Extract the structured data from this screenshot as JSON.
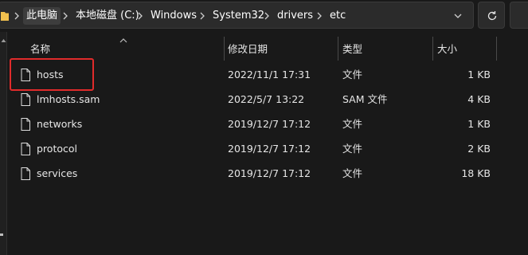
{
  "address_bar": {
    "breadcrumbs": [
      "此电脑",
      "本地磁盘 (C:)",
      "Windows",
      "System32",
      "drivers",
      "etc"
    ],
    "chevron_icon": "chevron-right-icon",
    "folder_icon": "folder-icon",
    "refresh_icon": "refresh-icon"
  },
  "columns": {
    "name": "名称",
    "modified": "修改日期",
    "type": "类型",
    "size": "大小"
  },
  "files": [
    {
      "name": "hosts",
      "modified": "2022/11/1 17:31",
      "type": "文件",
      "size": "1 KB",
      "selected_highlight": true
    },
    {
      "name": "lmhosts.sam",
      "modified": "2022/5/7 13:22",
      "type": "SAM 文件",
      "size": "4 KB"
    },
    {
      "name": "networks",
      "modified": "2019/12/7 17:12",
      "type": "文件",
      "size": "1 KB"
    },
    {
      "name": "protocol",
      "modified": "2019/12/7 17:12",
      "type": "文件",
      "size": "2 KB"
    },
    {
      "name": "services",
      "modified": "2019/12/7 17:12",
      "type": "文件",
      "size": "18 KB"
    }
  ],
  "colors": {
    "background": "#191919",
    "highlight_border": "#e02b2b",
    "folder_yellow": "#f2c14e"
  }
}
